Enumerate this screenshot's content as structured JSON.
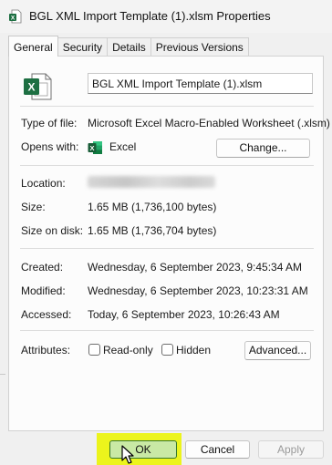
{
  "window": {
    "title": "BGL XML Import Template (1).xlsm Properties"
  },
  "tabs": [
    {
      "label": "General",
      "active": true
    },
    {
      "label": "Security",
      "active": false
    },
    {
      "label": "Details",
      "active": false
    },
    {
      "label": "Previous Versions",
      "active": false
    }
  ],
  "general": {
    "file_name": "BGL XML Import Template (1).xlsm",
    "type_of_file_label": "Type of file:",
    "type_of_file_value": "Microsoft Excel Macro-Enabled Worksheet (.xlsm)",
    "opens_with_label": "Opens with:",
    "opens_with_value": "Excel",
    "change_button": "Change...",
    "location_label": "Location:",
    "size_label": "Size:",
    "size_value": "1.65 MB (1,736,100 bytes)",
    "size_on_disk_label": "Size on disk:",
    "size_on_disk_value": "1.65 MB (1,736,704 bytes)",
    "created_label": "Created:",
    "created_value": "Wednesday, 6 September 2023, 9:45:34 AM",
    "modified_label": "Modified:",
    "modified_value": "Wednesday, 6 September 2023, 10:23:31 AM",
    "accessed_label": "Accessed:",
    "accessed_value": "Today, 6 September 2023, 10:26:43 AM",
    "attributes_label": "Attributes:",
    "readonly_label": "Read-only",
    "readonly_checked": false,
    "hidden_label": "Hidden",
    "hidden_checked": false,
    "advanced_button": "Advanced..."
  },
  "footer": {
    "ok_label": "OK",
    "cancel_label": "Cancel",
    "apply_label": "Apply"
  },
  "colors": {
    "excel_green": "#1d6f42",
    "ok_highlight": "#ecf41c",
    "ok_button_fill": "#c9e9a5"
  },
  "icons": [
    "excel-file-icon",
    "excel-app-icon",
    "mouse-pointer-icon"
  ]
}
